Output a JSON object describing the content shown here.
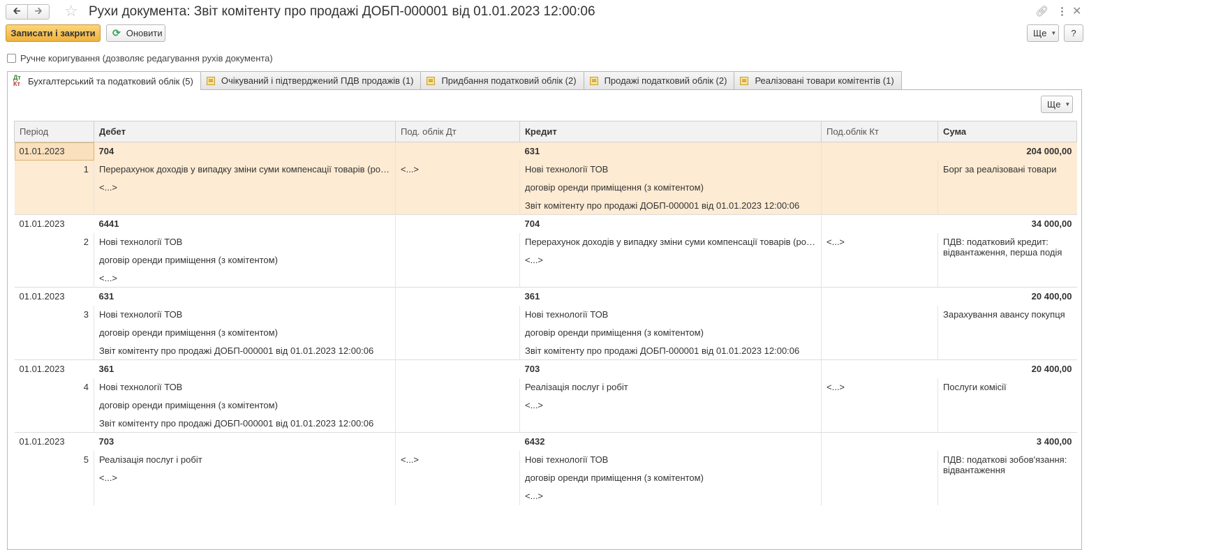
{
  "window": {
    "title": "Рухи документа: Звіт комітенту про продажі ДОБП-000001 від 01.01.2023 12:00:06",
    "back_icon": "arrow-left-icon",
    "forward_icon": "arrow-right-icon",
    "star_icon": "star-icon",
    "link_icon": "link-icon",
    "menu_icon": "kebab-menu-icon",
    "close_icon": "close-icon"
  },
  "toolbar": {
    "save_close_label": "Записати і закрити",
    "refresh_label": "Оновити",
    "more_label": "Ще",
    "help_label": "?"
  },
  "manual_edit": {
    "label": "Ручне коригування (дозволяє редагування рухів документа)",
    "checked": false
  },
  "tabs": [
    {
      "label": "Бухгалтерський та податковий облік (5)",
      "active": true
    },
    {
      "label": "Очікуваний і підтверджений ПДВ продажів (1)",
      "active": false
    },
    {
      "label": "Придбання податковий облік (2)",
      "active": false
    },
    {
      "label": "Продажі податковий облік (2)",
      "active": false
    },
    {
      "label": "Реалізовані товари комітентів (1)",
      "active": false
    }
  ],
  "panel": {
    "more_label": "Ще"
  },
  "table": {
    "columns": {
      "period": "Період",
      "debit": "Дебет",
      "debit_tax": "Под. облік Дт",
      "credit": "Кредит",
      "credit_tax": "Под.облік Кт",
      "sum": "Сума"
    },
    "records": [
      {
        "period": "01.01.2023",
        "n": "1",
        "debit": "704",
        "credit": "631",
        "sum": "204 000,00",
        "debit_lines": [
          "Перерахунок доходів у випадку зміни суми компенсації товарів (робіт, пос...",
          "<...>"
        ],
        "debit_tax": [
          "<...>"
        ],
        "credit_lines": [
          "Нові технології ТОВ",
          "договір оренди приміщення (з комітентом)",
          "Звіт комітенту про продажі ДОБП-000001 від 01.01.2023 12:00:06"
        ],
        "credit_tax": [],
        "content": "Борг за реалізовані товари"
      },
      {
        "period": "01.01.2023",
        "n": "2",
        "debit": "6441",
        "credit": "704",
        "sum": "34 000,00",
        "debit_lines": [
          "Нові технології ТОВ",
          "договір оренди приміщення (з комітентом)",
          "<...>"
        ],
        "debit_tax": [],
        "credit_lines": [
          "Перерахунок доходів у випадку зміни суми компенсації товарів (робіт, пос...",
          "<...>"
        ],
        "credit_tax": [
          "<...>"
        ],
        "content": "ПДВ: податковий кредит: відвантаження, перша подія"
      },
      {
        "period": "01.01.2023",
        "n": "3",
        "debit": "631",
        "credit": "361",
        "sum": "20 400,00",
        "debit_lines": [
          "Нові технології ТОВ",
          "договір оренди приміщення (з комітентом)",
          "Звіт комітенту про продажі ДОБП-000001 від 01.01.2023 12:00:06"
        ],
        "debit_tax": [],
        "credit_lines": [
          "Нові технології ТОВ",
          "договір оренди приміщення (з комітентом)",
          "Звіт комітенту про продажі ДОБП-000001 від 01.01.2023 12:00:06"
        ],
        "credit_tax": [],
        "content": "Зарахування авансу покупця"
      },
      {
        "period": "01.01.2023",
        "n": "4",
        "debit": "361",
        "credit": "703",
        "sum": "20 400,00",
        "debit_lines": [
          "Нові технології ТОВ",
          "договір оренди приміщення (з комітентом)",
          "Звіт комітенту про продажі ДОБП-000001 від 01.01.2023 12:00:06"
        ],
        "debit_tax": [],
        "credit_lines": [
          "Реалізація послуг і робіт",
          "<...>"
        ],
        "credit_tax": [
          "<...>"
        ],
        "content": "Послуги комісії"
      },
      {
        "period": "01.01.2023",
        "n": "5",
        "debit": "703",
        "credit": "6432",
        "sum": "3 400,00",
        "debit_lines": [
          "Реалізація послуг і робіт",
          "<...>"
        ],
        "debit_tax": [
          "<...>"
        ],
        "credit_lines": [
          "Нові технології ТОВ",
          "договір оренди приміщення (з комітентом)",
          "<...>"
        ],
        "credit_tax": [],
        "content": "ПДВ: податкові зобов'язання: відвантаження"
      }
    ]
  }
}
